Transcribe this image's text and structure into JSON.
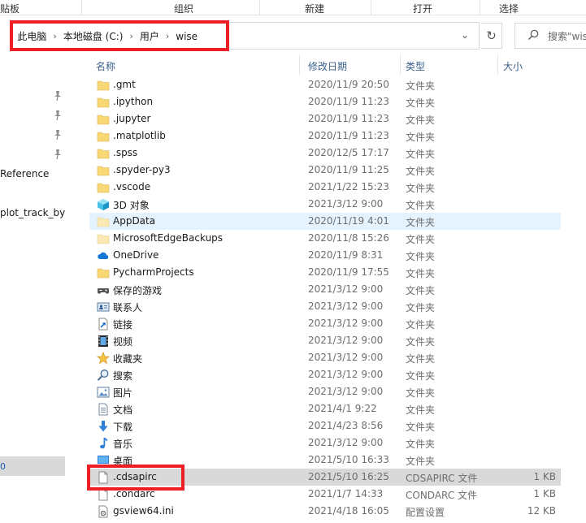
{
  "ribbon": {
    "groups": [
      "贴板",
      "组织",
      "新建",
      "打开",
      "选择"
    ]
  },
  "address": {
    "crumbs": [
      "此电脑",
      "本地磁盘 (C:)",
      "用户",
      "wise"
    ],
    "search_placeholder": "搜索\"wise\""
  },
  "nav": {
    "items": [
      "Reference",
      "plot_track_by_",
      "0"
    ]
  },
  "columns": {
    "name": "名称",
    "date": "修改日期",
    "type": "类型",
    "size": "大小"
  },
  "files": [
    {
      "name": ".gmt",
      "date": "2020/11/9 20:50",
      "type": "文件夹",
      "size": "",
      "icon": "folder-icon"
    },
    {
      "name": ".ipython",
      "date": "2020/11/9 11:23",
      "type": "文件夹",
      "size": "",
      "icon": "folder-icon"
    },
    {
      "name": ".jupyter",
      "date": "2020/11/9 11:23",
      "type": "文件夹",
      "size": "",
      "icon": "folder-icon"
    },
    {
      "name": ".matplotlib",
      "date": "2020/11/9 11:23",
      "type": "文件夹",
      "size": "",
      "icon": "folder-icon"
    },
    {
      "name": ".spss",
      "date": "2020/12/5 17:17",
      "type": "文件夹",
      "size": "",
      "icon": "folder-icon"
    },
    {
      "name": ".spyder-py3",
      "date": "2020/11/9 11:25",
      "type": "文件夹",
      "size": "",
      "icon": "folder-icon"
    },
    {
      "name": ".vscode",
      "date": "2021/1/22 15:23",
      "type": "文件夹",
      "size": "",
      "icon": "folder-icon"
    },
    {
      "name": "3D 对象",
      "date": "2021/3/12 9:00",
      "type": "文件夹",
      "size": "",
      "icon": "3d-objects-icon"
    },
    {
      "name": "AppData",
      "date": "2020/11/19 4:01",
      "type": "文件夹",
      "size": "",
      "icon": "folder-light-icon"
    },
    {
      "name": "MicrosoftEdgeBackups",
      "date": "2020/11/8 15:26",
      "type": "文件夹",
      "size": "",
      "icon": "folder-light-icon"
    },
    {
      "name": "OneDrive",
      "date": "2020/11/9 8:31",
      "type": "文件夹",
      "size": "",
      "icon": "onedrive-icon"
    },
    {
      "name": "PycharmProjects",
      "date": "2020/11/9 17:55",
      "type": "文件夹",
      "size": "",
      "icon": "folder-icon"
    },
    {
      "name": "保存的游戏",
      "date": "2021/3/12 9:00",
      "type": "文件夹",
      "size": "",
      "icon": "saved-games-icon"
    },
    {
      "name": "联系人",
      "date": "2021/3/12 9:00",
      "type": "文件夹",
      "size": "",
      "icon": "contacts-icon"
    },
    {
      "name": "链接",
      "date": "2021/3/12 9:00",
      "type": "文件夹",
      "size": "",
      "icon": "links-icon"
    },
    {
      "name": "视频",
      "date": "2021/3/12 9:00",
      "type": "文件夹",
      "size": "",
      "icon": "videos-icon"
    },
    {
      "name": "收藏夹",
      "date": "2021/3/12 9:00",
      "type": "文件夹",
      "size": "",
      "icon": "favorites-icon"
    },
    {
      "name": "搜索",
      "date": "2021/3/12 9:00",
      "type": "文件夹",
      "size": "",
      "icon": "searches-icon"
    },
    {
      "name": "图片",
      "date": "2021/3/12 9:00",
      "type": "文件夹",
      "size": "",
      "icon": "pictures-icon"
    },
    {
      "name": "文档",
      "date": "2021/4/1 9:22",
      "type": "文件夹",
      "size": "",
      "icon": "documents-icon"
    },
    {
      "name": "下载",
      "date": "2021/4/23 8:56",
      "type": "文件夹",
      "size": "",
      "icon": "downloads-icon"
    },
    {
      "name": "音乐",
      "date": "2021/3/12 9:00",
      "type": "文件夹",
      "size": "",
      "icon": "music-icon"
    },
    {
      "name": "桌面",
      "date": "2021/5/10 16:33",
      "type": "文件夹",
      "size": "",
      "icon": "desktop-icon"
    },
    {
      "name": ".cdsapirc",
      "date": "2021/5/10 16:25",
      "type": "CDSAPIRC 文件",
      "size": "1 KB",
      "icon": "file-icon"
    },
    {
      "name": ".condarc",
      "date": "2021/1/7 14:33",
      "type": "CONDARC 文件",
      "size": "1 KB",
      "icon": "file-icon"
    },
    {
      "name": "gsview64.ini",
      "date": "2021/4/18 16:05",
      "type": "配置设置",
      "size": "12 KB",
      "icon": "settings-file-icon"
    }
  ],
  "colors": {
    "highlight_box": "#ec1f27",
    "folder": "#f8d775",
    "selection": "#d9d9d9",
    "hover": "#e5f3ff"
  }
}
